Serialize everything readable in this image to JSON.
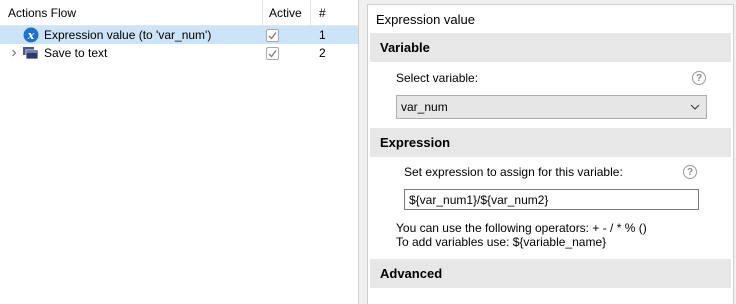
{
  "actions_flow": {
    "columns": {
      "name": "Actions Flow",
      "active": "Active",
      "number": "#"
    },
    "rows": [
      {
        "label": "Expression value (to 'var_num')",
        "icon": "expression-x-icon",
        "active": true,
        "number": "1",
        "selected": true,
        "expandable": false
      },
      {
        "label": "Save to text",
        "icon": "save-stack-icon",
        "active": true,
        "number": "2",
        "selected": false,
        "expandable": true
      }
    ]
  },
  "properties": {
    "title": "Expression value",
    "variable_section": {
      "header": "Variable",
      "select_label": "Select variable:",
      "selected_value": "var_num",
      "help": "?"
    },
    "expression_section": {
      "header": "Expression",
      "label": "Set expression to assign for this variable:",
      "value": "${var_num1}/${var_num2}",
      "help": "?",
      "hint_operators": "You can use the following operators: + - / * % ()",
      "hint_variables": "To add variables use: ${variable_name}"
    },
    "advanced_section": {
      "header": "Advanced"
    }
  },
  "colors": {
    "selection": "#cce4f7",
    "section_header": "#e7e7e7",
    "expression_icon": "#1e73c8"
  }
}
